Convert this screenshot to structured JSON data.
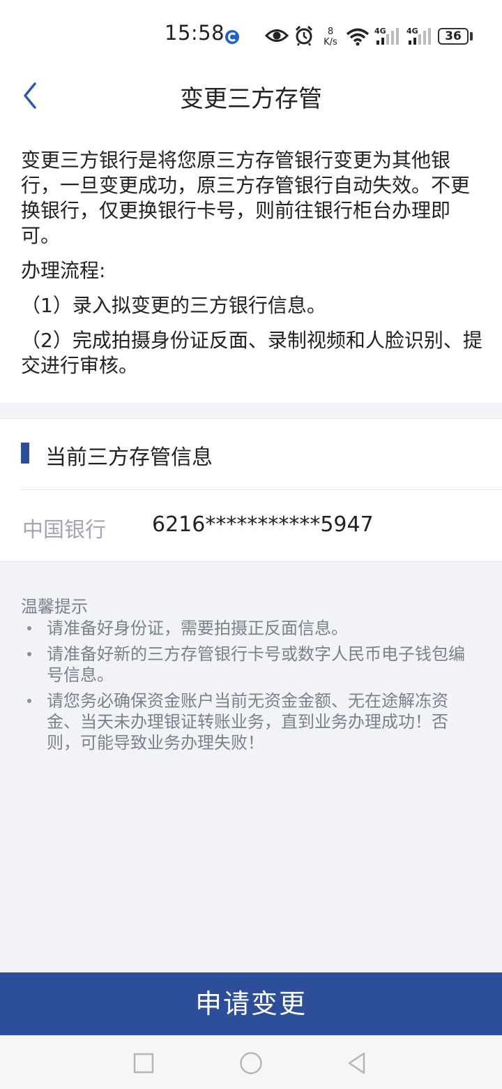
{
  "status_bar": {
    "time": "15:58",
    "speed_value": "8",
    "speed_unit": "K/s",
    "network_1": "4G",
    "network_2": "4G",
    "battery": "36",
    "icons": [
      "browser-app-icon",
      "eye-icon",
      "alarm-icon",
      "wifi-icon",
      "signal-icon",
      "signal-icon",
      "battery-icon"
    ]
  },
  "header": {
    "title": "变更三方存管",
    "back_icon": "chevron-left-icon"
  },
  "intro": {
    "paragraph": "变更三方银行是将您原三方存管银行变更为其他银行，一旦变更成功，原三方存管银行自动失效。不更换银行，仅更换银行卡号，则前往银行柜台办理即可。",
    "process_label": "办理流程:",
    "steps": [
      "（1）录入拟变更的三方银行信息。",
      "（2）完成拍摄身份证反面、录制视频和人脸识别、提交进行审核。"
    ]
  },
  "current_info": {
    "section_title": "当前三方存管信息",
    "bank_name": "中国银行",
    "card_number": "6216***********5947"
  },
  "tips": {
    "title": "温馨提示",
    "items": [
      "请准备好身份证，需要拍摄正反面信息。",
      "请准备好新的三方存管银行卡号或数字人民币电子钱包编号信息。",
      "请您务必确保资金账户当前无资金金额、无在途解冻资金、当天未办理银证转账业务，直到业务办理成功！否则，可能导致业务办理失败！"
    ]
  },
  "submit_label": "申请变更",
  "nav_bar": {
    "icons": [
      "recent-apps-icon",
      "home-icon",
      "back-icon"
    ]
  },
  "colors": {
    "accent": "#2d4f9a",
    "page_bg": "#f2f3f7",
    "muted_text": "#7c808a",
    "bank_label": "#a3a7b3"
  }
}
